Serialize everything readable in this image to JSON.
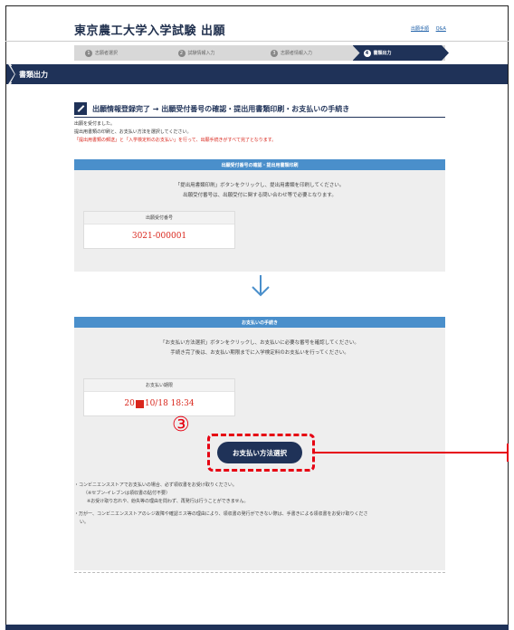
{
  "header": {
    "title": "東京農工大学入学試験 出願",
    "links": [
      "出願手順",
      "Q&A"
    ]
  },
  "steps": [
    {
      "num": "1",
      "label": "志願者選択"
    },
    {
      "num": "2",
      "label": "試験情報入力"
    },
    {
      "num": "3",
      "label": "志願者情報入力"
    },
    {
      "num": "4",
      "label": "書類出力"
    }
  ],
  "section": {
    "title": "書類出力"
  },
  "main": {
    "heading": "出願情報登録完了 → 出願受付番号の確認・提出用書類印刷・お支払いの手続き",
    "line1": "出願を受付ました。",
    "line2": "提出用書類の印刷と、お支払い方法を選択してください。",
    "line3": "「提出用書類の郵送」と「入学検定料のお支払い」を行って、出願手続きがすべて完了となります。"
  },
  "box1": {
    "header": "出願受付番号の確認・提出用書類印刷",
    "text1": "「提出用書類印刷」ボタンをクリックし、提出用書類を印刷してください。",
    "text2": "出願受付番号は、出願受付に関する問い合わせ等で必要となります。",
    "card_label": "出願受付番号",
    "card_value": "3021-000001"
  },
  "box2": {
    "header": "お支払いの手続き",
    "text1": "「お支払い方法選択」ボタンをクリックし、お支払いに必要な番号を確認してください。",
    "text2": "手続き完了後は、お支払い期限までに入学検定料のお支払いを行ってください。",
    "card_label": "お支払い期限",
    "value_prefix": "20",
    "value_suffix": "10/18 18:34",
    "button": "お支払い方法選択"
  },
  "annotation": {
    "number": "③"
  },
  "notes": [
    "・コンビニエンスストアでお支払いの場合、必ず領収書をお受け取りください。",
    "（※セブン-イレブンは領収書の貼付不要）",
    "※お受け取り忘れや、紛失等の理由を問わず、再発行は行うことができません。",
    "・万が一、コンビニエンスストアのレジ故障や確認ミス等の理由により、領収書の発行ができない際は、手書きによる領収書をお受け取りくださ",
    "い。"
  ],
  "colors": {
    "navy": "#1f3258",
    "blue": "#4a8fcb",
    "red": "#d9261c",
    "annotation": "#e60012"
  }
}
